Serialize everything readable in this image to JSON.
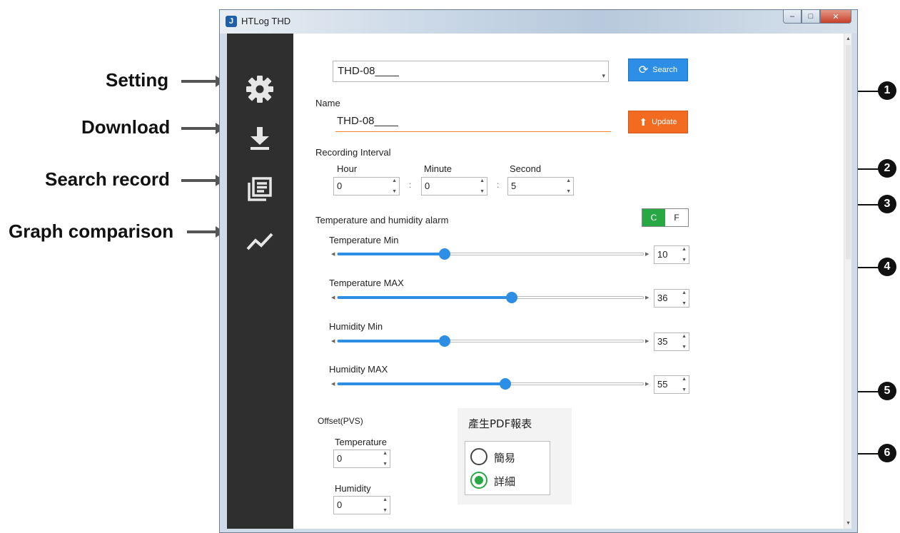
{
  "annotations": {
    "labels": [
      "Setting",
      "Download",
      "Search record",
      "Graph comparison"
    ],
    "callouts": [
      "1",
      "2",
      "3",
      "4",
      "5",
      "6"
    ]
  },
  "window": {
    "title": "HTLog THD",
    "controls": {
      "minimize": "–",
      "maximize": "□",
      "close": "✕"
    }
  },
  "sidebar": {
    "items": [
      {
        "name": "Setting",
        "icon": "gear-icon"
      },
      {
        "name": "Download",
        "icon": "download-icon"
      },
      {
        "name": "Search record",
        "icon": "records-icon"
      },
      {
        "name": "Graph comparison",
        "icon": "chart-line-icon"
      }
    ]
  },
  "device": {
    "selected": "THD-08____",
    "search_label": "Search"
  },
  "name_section": {
    "label": "Name",
    "value": "THD-08____",
    "update_label": "Update"
  },
  "interval": {
    "label": "Recording Interval",
    "hour_label": "Hour",
    "hour": "0",
    "minute_label": "Minute",
    "minute": "0",
    "second_label": "Second",
    "second": "5",
    "sep": ":"
  },
  "alarm": {
    "label": "Temperature and humidity alarm",
    "unit_c": "C",
    "unit_f": "F",
    "selected_unit": "C",
    "sliders": [
      {
        "label": "Temperature Min",
        "value": "10",
        "fraction": 0.35
      },
      {
        "label": "Temperature MAX",
        "value": "36",
        "fraction": 0.57
      },
      {
        "label": "Humidity Min",
        "value": "35",
        "fraction": 0.35
      },
      {
        "label": "Humidity MAX",
        "value": "55",
        "fraction": 0.55
      }
    ]
  },
  "offset": {
    "label": "Offset(PVS)",
    "temperature_label": "Temperature",
    "temperature": "0",
    "humidity_label": "Humidity",
    "humidity": "0"
  },
  "pdf": {
    "title": "產生PDF報表",
    "options": [
      "簡易",
      "詳細"
    ],
    "selected": "詳細"
  },
  "colors": {
    "sidebar": "#2f2f2f",
    "accent_blue": "#2d8ee6",
    "accent_orange": "#f26b21",
    "accent_green": "#27a844"
  }
}
